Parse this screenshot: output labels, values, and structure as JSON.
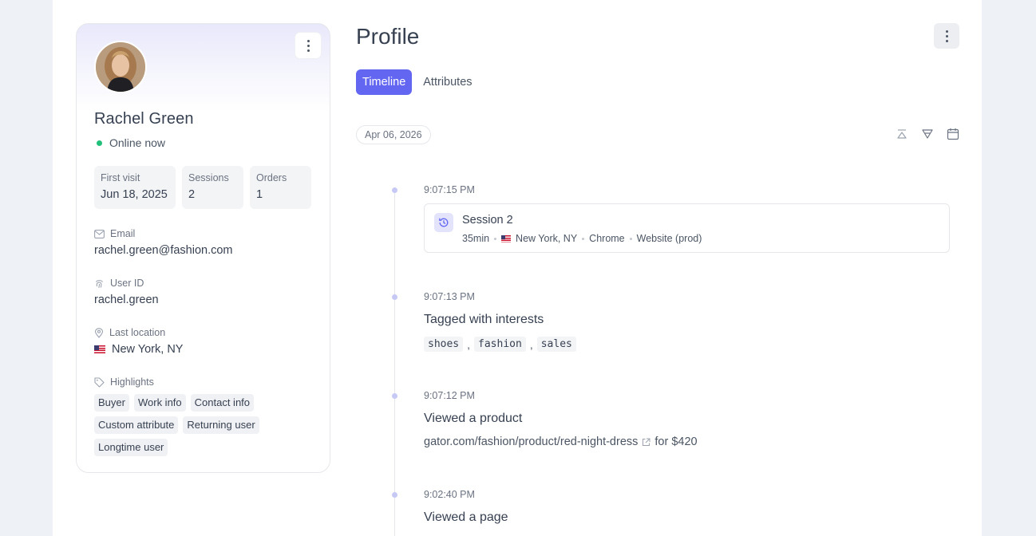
{
  "profile": {
    "name": "Rachel Green",
    "status": "Online now",
    "stats": [
      {
        "label": "First visit",
        "value": "Jun 18, 2025"
      },
      {
        "label": "Sessions",
        "value": "2"
      },
      {
        "label": "Orders",
        "value": "1"
      }
    ],
    "email_label": "Email",
    "email": "rachel.green@fashion.com",
    "user_id_label": "User ID",
    "user_id": "rachel.green",
    "location_label": "Last location",
    "location": "New York, NY",
    "highlights_label": "Highlights",
    "highlights": [
      "Buyer",
      "Work info",
      "Contact info",
      "Custom attribute",
      "Returning user",
      "Longtime user"
    ]
  },
  "header": {
    "title": "Profile",
    "tabs": [
      "Timeline",
      "Attributes"
    ],
    "active_tab": "Timeline"
  },
  "timeline": {
    "date": "Apr 06, 2026",
    "events": [
      {
        "time": "9:07:15 PM",
        "title": "Session 2",
        "meta": [
          "35min",
          "New York, NY",
          "Chrome",
          "Website (prod)"
        ]
      },
      {
        "time": "9:07:13 PM",
        "title": "Tagged with interests",
        "interests": [
          "shoes",
          "fashion",
          "sales"
        ],
        "separator": ","
      },
      {
        "time": "9:07:12 PM",
        "title": "Viewed a product",
        "url": "gator.com/fashion/product/red-night-dress",
        "suffix": "for $420"
      },
      {
        "time": "9:02:40 PM",
        "title": "Viewed a page"
      }
    ]
  },
  "colors": {
    "accent": "#6366f1",
    "online": "#22c07a",
    "timeline_dot": "#c7c9f5"
  }
}
